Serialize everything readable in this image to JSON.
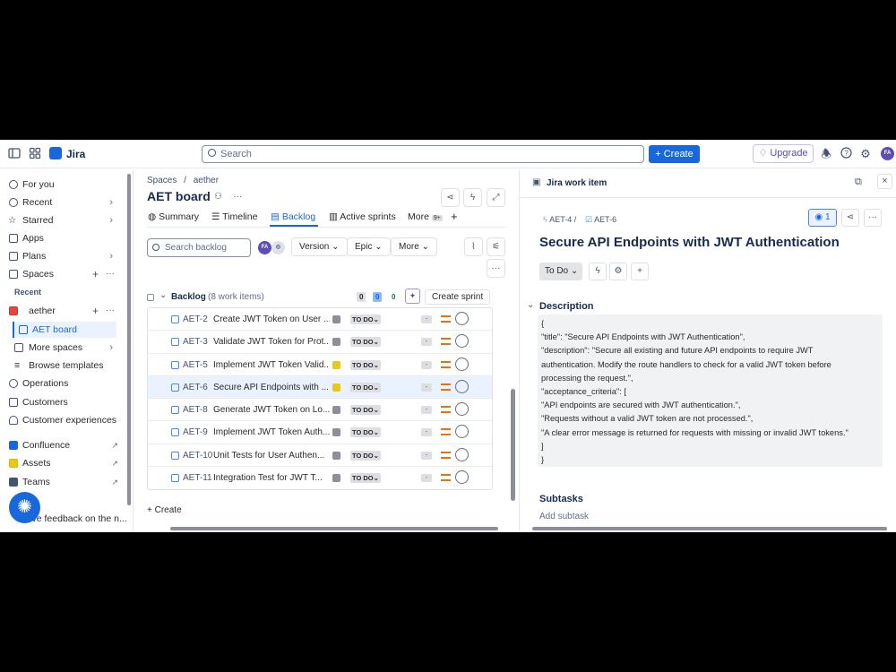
{
  "topbar": {
    "app_name": "Jira",
    "search_placeholder": "Search",
    "create_label": "Create",
    "upgrade_label": "Upgrade",
    "avatar_initials": "FA"
  },
  "sidebar": {
    "items": [
      {
        "label": "For you"
      },
      {
        "label": "Recent"
      },
      {
        "label": "Starred"
      },
      {
        "label": "Apps"
      },
      {
        "label": "Plans"
      },
      {
        "label": "Spaces"
      }
    ],
    "recent_heading": "Recent",
    "space_name": "aether",
    "board_name": "AET board",
    "more_spaces": "More spaces",
    "browse_templates": "Browse templates",
    "bottom_items": [
      {
        "label": "Operations"
      },
      {
        "label": "Customers"
      },
      {
        "label": "Customer experiences"
      }
    ],
    "apps": [
      {
        "label": "Confluence"
      },
      {
        "label": "Assets"
      },
      {
        "label": "Teams"
      }
    ],
    "feedback": "Give feedback on the n..."
  },
  "main": {
    "breadcrumb_spaces": "Spaces",
    "breadcrumb_sep": "/",
    "breadcrumb_project": "aether",
    "title": "AET board",
    "tabs": [
      {
        "label": "Summary"
      },
      {
        "label": "Timeline"
      },
      {
        "label": "Backlog"
      },
      {
        "label": "Active sprints"
      },
      {
        "label": "More"
      }
    ],
    "more_badge": "9+",
    "search_placeholder": "Search backlog",
    "avatar_initials": "FA",
    "filters": {
      "version": "Version",
      "epic": "Epic",
      "more": "More"
    },
    "backlog": {
      "title": "Backlog",
      "count": "(8 work items)",
      "counts": [
        "0",
        "0",
        "0"
      ],
      "create_sprint": "Create sprint"
    },
    "rows": [
      {
        "key": "AET-2",
        "summary": "Create JWT Token on User ...",
        "status": "TO DO",
        "est": "-",
        "epic_color": "#8c8f97"
      },
      {
        "key": "AET-3",
        "summary": "Validate JWT Token for Prot...",
        "status": "TO DO",
        "est": "-",
        "epic_color": "#8c8f97"
      },
      {
        "key": "AET-5",
        "summary": "Implement JWT Token Valid...",
        "status": "TO DO",
        "est": "-",
        "epic_color": "#e8c81c"
      },
      {
        "key": "AET-6",
        "summary": "Secure API Endpoints with ...",
        "status": "TO DO",
        "est": "-",
        "epic_color": "#e8c81c"
      },
      {
        "key": "AET-8",
        "summary": "Generate JWT Token on Lo...",
        "status": "TO DO",
        "est": "-",
        "epic_color": "#8c8f97"
      },
      {
        "key": "AET-9",
        "summary": "Implement JWT Token Auth...",
        "status": "TO DO",
        "est": "-",
        "epic_color": "#8c8f97"
      },
      {
        "key": "AET-10",
        "summary": "Unit Tests for User Authen...",
        "status": "TO DO",
        "est": "-",
        "epic_color": "#8c8f97"
      },
      {
        "key": "AET-11",
        "summary": "Integration Test for JWT T...",
        "status": "TO DO",
        "est": "-",
        "epic_color": "#8c8f97"
      }
    ],
    "create_label": "+ Create"
  },
  "panel": {
    "title": "Jira work item",
    "parent_key": "AET-4",
    "key": "AET-6",
    "watchers": "1",
    "work_title": "Secure API Endpoints with JWT Authentication",
    "status": "To Do",
    "description_label": "Description",
    "description_lines": [
      "{",
      "\"title\": \"Secure API Endpoints with JWT Authentication\",",
      "\"description\": \"Secure all existing and future API endpoints to require JWT",
      "authentication. Modify the route handlers to check for a valid JWT token before",
      "processing the request.\",",
      "\"acceptance_criteria\": [",
      "\"API endpoints are secured with JWT authentication.\",",
      "\"Requests without a valid JWT token are not processed.\",",
      "\"A clear error message is returned for requests with missing or invalid JWT tokens.\"",
      "]",
      "}"
    ],
    "subtasks_label": "Subtasks",
    "add_subtask": "Add subtask"
  }
}
